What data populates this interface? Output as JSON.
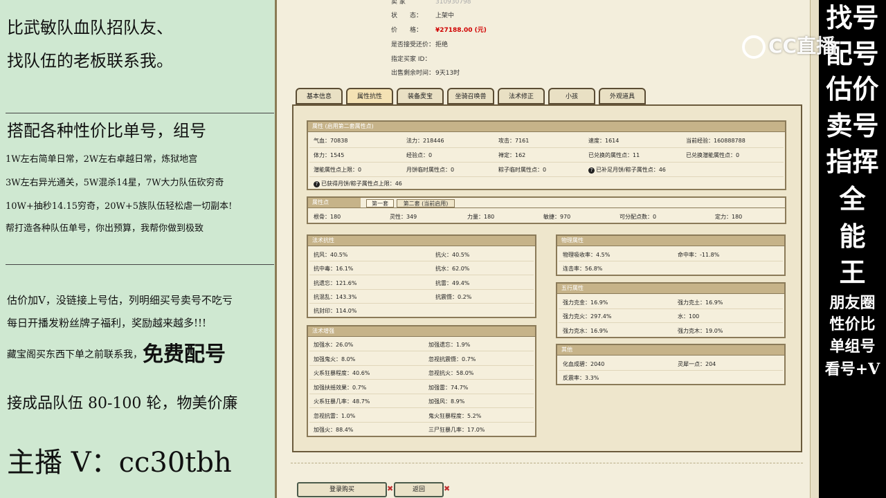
{
  "left_panel": {
    "lines1": [
      "比武敏队血队招队友、",
      "找队伍的老板联系我。"
    ],
    "heading2": "搭配各种性价比单号，组号",
    "lines2": [
      "1W左右简单日常，2W左右卓越日常，炼狱地宫",
      "3W左右异光通关，5W混杀14星，7W大力队伍砍穷奇",
      "10W+抽秒14.15穷奇，20W+5族队伍轻松虐一切副本!",
      "帮打造各种队伍单号，你出预算，我帮你做到极致"
    ],
    "lines3": [
      "估价加V，没链接上号估，列明细买号卖号不吃亏",
      "每日开播发粉丝牌子福利，奖励越来越多!!!"
    ],
    "line4_prefix": "藏宝阁买东西下单之前联系我，",
    "line4_big": "免费配号",
    "line5": "接成品队伍 80-100 轮，物美价廉",
    "contact": "主播 V：cc30tbh"
  },
  "right_panel": {
    "big_chars": [
      "找号",
      "配号",
      "估价",
      "卖号",
      "指挥",
      "全",
      "能",
      "王"
    ],
    "small_lines": [
      "朋友圈",
      "性价比",
      "单组号",
      "看号+V"
    ],
    "logo_text": "CC直播"
  },
  "listing": {
    "seller_label": "卖 家",
    "seller_value": "310930798",
    "status_label": "状　　态：",
    "status_value": "上架中",
    "price_label": "价　　格：",
    "price_value": "¥27188.00 (元)",
    "bargain_label": "是否接受还价：",
    "bargain_value": "拒绝",
    "buyer_label": "指定买家 ID：",
    "buyer_value": "",
    "remaining_label": "出售剩余时间：",
    "remaining_value": "9天13时"
  },
  "tabs": [
    "基本信息",
    "属性抗性",
    "装备灵宝",
    "坐骑召唤兽",
    "法术修正",
    "小孩",
    "外观道具"
  ],
  "attr": {
    "title": "属性 (启用第二套属性点)",
    "rows": [
      [
        "气血：70838",
        "法力：218446",
        "攻击：7161",
        "速度：1614",
        "当前经验：160888788"
      ],
      [
        "体力：1545",
        "经验点：0",
        "禅定：162",
        "已兑换的属性点：11",
        "已兑换潜能属性点：0"
      ],
      [
        "潜能属性点上限：0",
        "月饼临时属性点：0",
        "粽子临时属性点：0",
        "已补足月饼/粽子属性点：46",
        ""
      ],
      [
        "已获得月饼/粽子属性点上限：46",
        "",
        "",
        "",
        ""
      ]
    ]
  },
  "points": {
    "title": "属性点",
    "subtabs": [
      "第一套",
      "第二套 (当前启用)"
    ],
    "row": [
      "根骨：180",
      "灵性：349",
      "力量：180",
      "敏捷：970",
      "可分配点数：0",
      "定力：180"
    ]
  },
  "resist": {
    "title": "法术抗性",
    "rows": [
      [
        "抗风：40.5%",
        "抗火：40.5%"
      ],
      [
        "抗中毒：16.1%",
        "抗水：62.0%"
      ],
      [
        "抗遗忘：121.6%",
        "抗雷：49.4%"
      ],
      [
        "抗混乱：143.3%",
        "抗震慑：0.2%"
      ],
      [
        "抗封印：114.0%",
        ""
      ]
    ]
  },
  "enhance": {
    "title": "法术增强",
    "rows": [
      [
        "加强水：26.0%",
        "加强遗忘：1.9%"
      ],
      [
        "加强鬼火：8.0%",
        "忽视抗震慑：0.7%"
      ],
      [
        "火系狂暴程度：40.6%",
        "忽视抗火：58.0%"
      ],
      [
        "加强扶摇效果：0.7%",
        "加强雷：74.7%"
      ],
      [
        "火系狂暴几率：48.7%",
        "加强风：8.9%"
      ],
      [
        "忽视抗雷：1.0%",
        "鬼火狂暴程度：5.2%"
      ],
      [
        "加强火：88.4%",
        "三尸狂暴几率：17.0%"
      ]
    ]
  },
  "physical": {
    "title": "物理属性",
    "rows": [
      [
        "物理吸收率：4.5%",
        "命中率：-11.8%"
      ],
      [
        "连击率：56.8%",
        ""
      ]
    ]
  },
  "five": {
    "title": "五行属性",
    "rows": [
      [
        "强力克金：16.9%",
        "强力克土：16.9%"
      ],
      [
        "强力克火：297.4%",
        "水：100"
      ],
      [
        "强力克水：16.9%",
        "强力克木：19.0%"
      ]
    ]
  },
  "other": {
    "title": "其他",
    "rows": [
      [
        "化血成碧：2040",
        "灵犀一点：204"
      ],
      [
        "反震率：3.3%",
        ""
      ]
    ]
  },
  "buttons": {
    "buy": "登录购买",
    "back": "返回"
  }
}
